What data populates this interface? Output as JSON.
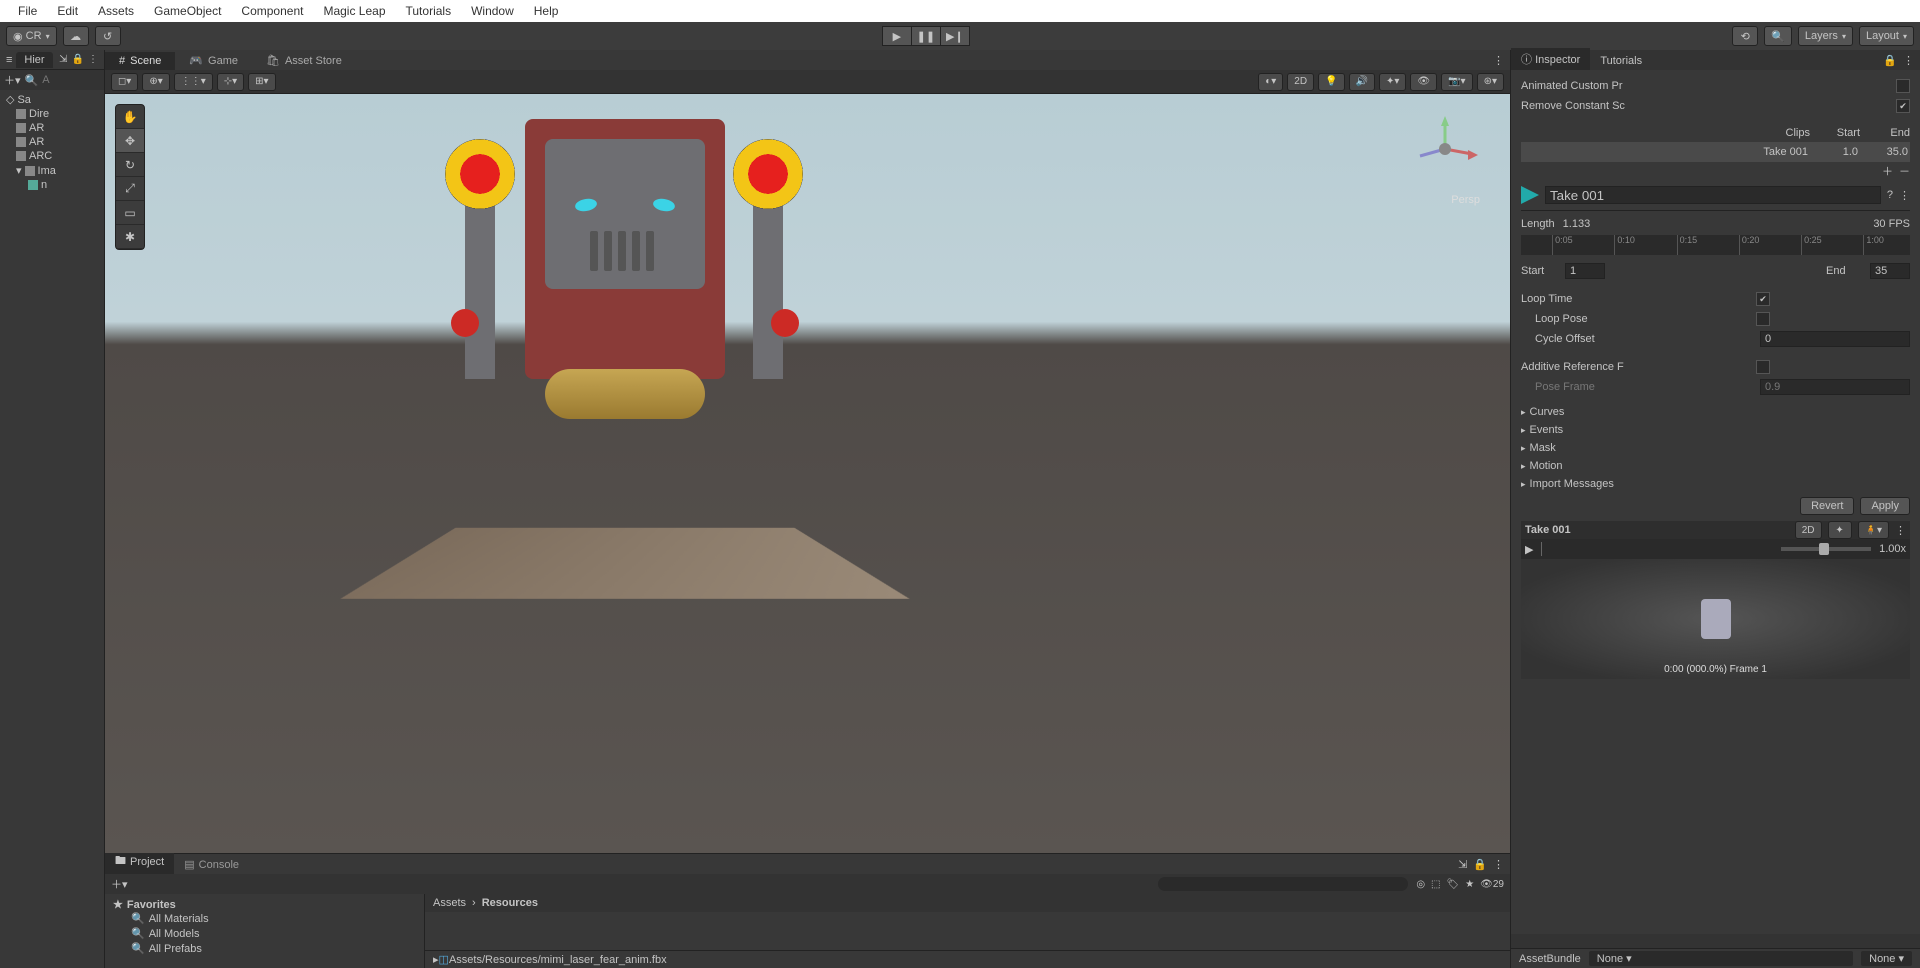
{
  "menu": [
    "File",
    "Edit",
    "Assets",
    "GameObject",
    "Component",
    "Magic Leap",
    "Tutorials",
    "Window",
    "Help"
  ],
  "toolbar": {
    "cr_label": "CR",
    "layers": "Layers",
    "layout": "Layout"
  },
  "hierarchy": {
    "tab": "Hier",
    "items": [
      "Sa",
      "Dire",
      "AR",
      "AR",
      "ARC",
      "Ima",
      "n"
    ]
  },
  "view_tabs": {
    "scene": "Scene",
    "game": "Game",
    "store": "Asset Store"
  },
  "scene": {
    "persp": "Persp",
    "mode2d": "2D"
  },
  "inspector": {
    "tab_inspector": "Inspector",
    "tab_tutorials": "Tutorials",
    "anim_custom": "Animated Custom Pr",
    "remove_const": "Remove Constant Sc",
    "clips_hdr": {
      "clips": "Clips",
      "start": "Start",
      "end": "End"
    },
    "clip": {
      "name": "Take 001",
      "start": "1.0",
      "end": "35.0"
    },
    "clip_name_field": "Take 001",
    "length_lbl": "Length",
    "length_val": "1.133",
    "fps": "30 FPS",
    "ticks": [
      "0:05",
      "0:10",
      "0:15",
      "0:20",
      "0:25",
      "1:00"
    ],
    "start_lbl": "Start",
    "start_val": "1",
    "end_lbl": "End",
    "end_val": "35",
    "loop_time": "Loop Time",
    "loop_pose": "Loop Pose",
    "cycle_offset": "Cycle Offset",
    "cycle_val": "0",
    "additive": "Additive Reference F",
    "pose_frame": "Pose Frame",
    "pose_val": "0.9",
    "foldouts": [
      "Curves",
      "Events",
      "Mask",
      "Motion",
      "Import Messages"
    ],
    "revert": "Revert",
    "apply": "Apply",
    "preview": {
      "title": "Take 001",
      "mode2d": "2D",
      "speed": "1.00x",
      "frame": "0:00 (000.0%) Frame 1"
    },
    "assetbundle_lbl": "AssetBundle",
    "assetbundle_val": "None",
    "assetbundle_var": "None"
  },
  "project": {
    "tab_project": "Project",
    "tab_console": "Console",
    "vis_count": "29",
    "favorites": "Favorites",
    "fav_items": [
      "All Materials",
      "All Models",
      "All Prefabs"
    ],
    "crumb_root": "Assets",
    "crumb_cur": "Resources",
    "selected_path": "Assets/Resources/mimi_laser_fear_anim.fbx"
  }
}
